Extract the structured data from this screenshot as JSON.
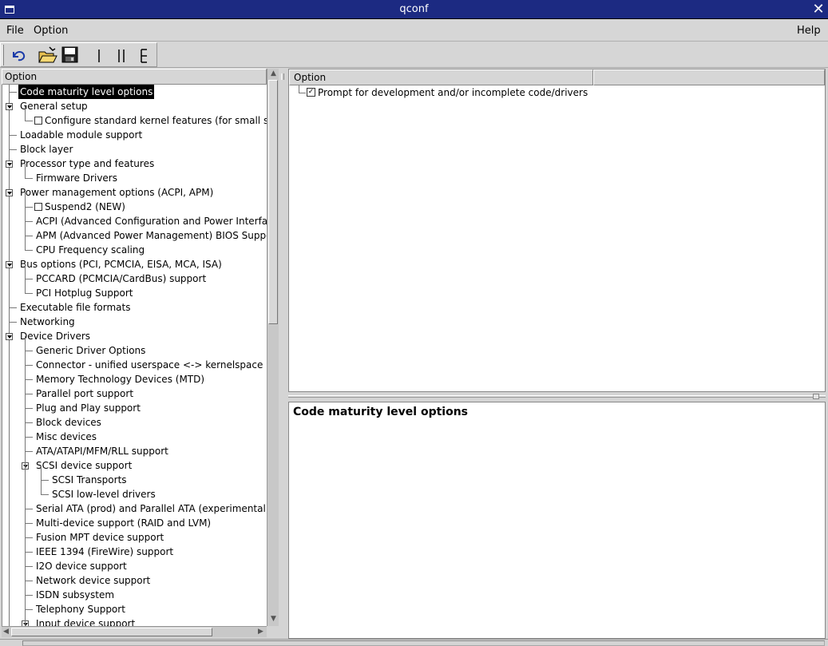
{
  "window": {
    "title": "qconf"
  },
  "menu": {
    "file": "File",
    "option": "Option",
    "help": "Help"
  },
  "tree": {
    "header": "Option",
    "rows": [
      {
        "label": "Code maturity level options",
        "level": 0,
        "selected": true
      },
      {
        "label": "General setup",
        "level": 0,
        "expander": true
      },
      {
        "label": "Configure standard kernel features (for small systems)",
        "level": 1,
        "checkbox": true,
        "checked": false
      },
      {
        "label": "Loadable module support",
        "level": 0
      },
      {
        "label": "Block layer",
        "level": 0
      },
      {
        "label": "Processor type and features",
        "level": 0,
        "expander": true
      },
      {
        "label": "Firmware Drivers",
        "level": 1
      },
      {
        "label": "Power management options (ACPI, APM)",
        "level": 0,
        "expander": true
      },
      {
        "label": "Suspend2 (NEW)",
        "level": 1,
        "checkbox": true,
        "checked": false
      },
      {
        "label": "ACPI (Advanced Configuration and Power Interface) Support",
        "level": 1
      },
      {
        "label": "APM (Advanced Power Management) BIOS Support",
        "level": 1
      },
      {
        "label": "CPU Frequency scaling",
        "level": 1
      },
      {
        "label": "Bus options (PCI, PCMCIA, EISA, MCA, ISA)",
        "level": 0,
        "expander": true
      },
      {
        "label": "PCCARD (PCMCIA/CardBus) support",
        "level": 1
      },
      {
        "label": "PCI Hotplug Support",
        "level": 1
      },
      {
        "label": "Executable file formats",
        "level": 0
      },
      {
        "label": "Networking",
        "level": 0
      },
      {
        "label": "Device Drivers",
        "level": 0,
        "expander": true
      },
      {
        "label": "Generic Driver Options",
        "level": 1
      },
      {
        "label": "Connector - unified userspace <-> kernelspace linker",
        "level": 1
      },
      {
        "label": "Memory Technology Devices (MTD)",
        "level": 1
      },
      {
        "label": "Parallel port support",
        "level": 1
      },
      {
        "label": "Plug and Play support",
        "level": 1
      },
      {
        "label": "Block devices",
        "level": 1
      },
      {
        "label": "Misc devices",
        "level": 1
      },
      {
        "label": "ATA/ATAPI/MFM/RLL support",
        "level": 1
      },
      {
        "label": "SCSI device support",
        "level": 1,
        "expander": true
      },
      {
        "label": "SCSI Transports",
        "level": 2
      },
      {
        "label": "SCSI low-level drivers",
        "level": 2
      },
      {
        "label": "Serial ATA (prod) and Parallel ATA (experimental) drivers",
        "level": 1
      },
      {
        "label": "Multi-device support (RAID and LVM)",
        "level": 1
      },
      {
        "label": "Fusion MPT device support",
        "level": 1
      },
      {
        "label": "IEEE 1394 (FireWire) support",
        "level": 1
      },
      {
        "label": "I2O device support",
        "level": 1
      },
      {
        "label": "Network device support",
        "level": 1
      },
      {
        "label": "ISDN subsystem",
        "level": 1
      },
      {
        "label": "Telephony Support",
        "level": 1
      },
      {
        "label": "Input device support",
        "level": 1,
        "expander": true
      }
    ]
  },
  "options_list": {
    "header": "Option",
    "rows": [
      {
        "label": "Prompt for development and/or incomplete code/drivers",
        "checked": true
      }
    ]
  },
  "help_panel": {
    "title": "Code maturity level options"
  },
  "icons": [
    "back-icon",
    "open-folder-icon",
    "save-icon",
    "single-view-icon",
    "split-view-icon",
    "full-view-icon"
  ]
}
